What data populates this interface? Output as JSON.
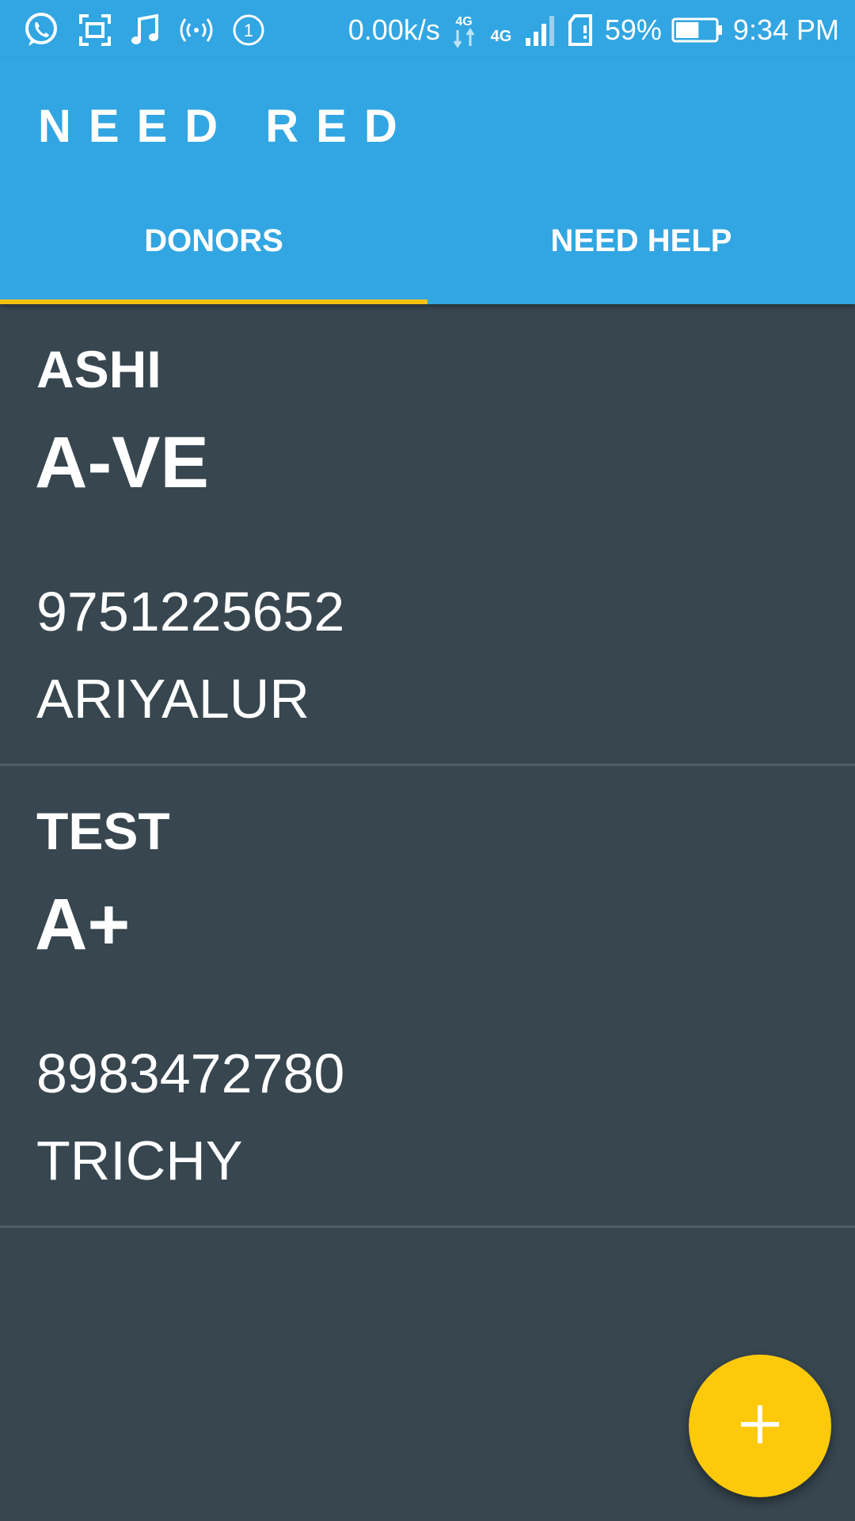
{
  "status_bar": {
    "network_speed": "0.00k/s",
    "network_type_1": "4G",
    "network_type_2": "4G",
    "battery_percent": "59%",
    "battery_level": 0.59,
    "time": "9:34 PM",
    "notification_count": "1",
    "icons": [
      "whatsapp-icon",
      "screenshot-icon",
      "music-icon",
      "hotspot-icon",
      "notification-count-icon",
      "data-transfer-icon",
      "signal-icon",
      "sim-icon",
      "battery-icon"
    ]
  },
  "app_bar": {
    "title": "NEED RED"
  },
  "tabs": [
    {
      "label": "DONORS",
      "selected": true
    },
    {
      "label": "NEED HELP",
      "selected": false
    }
  ],
  "donors": [
    {
      "name": "ASHI",
      "blood_group": "A-VE",
      "phone": "9751225652",
      "city": "ARIYALUR"
    },
    {
      "name": "TEST",
      "blood_group": "A+",
      "phone": "8983472780",
      "city": "TRICHY"
    }
  ],
  "fab": {
    "icon": "plus-icon"
  },
  "colors": {
    "primary": "#31a6e2",
    "accent": "#fcc90b",
    "background": "#37464f",
    "divider": "#4d5c65",
    "text": "#ffffff"
  }
}
